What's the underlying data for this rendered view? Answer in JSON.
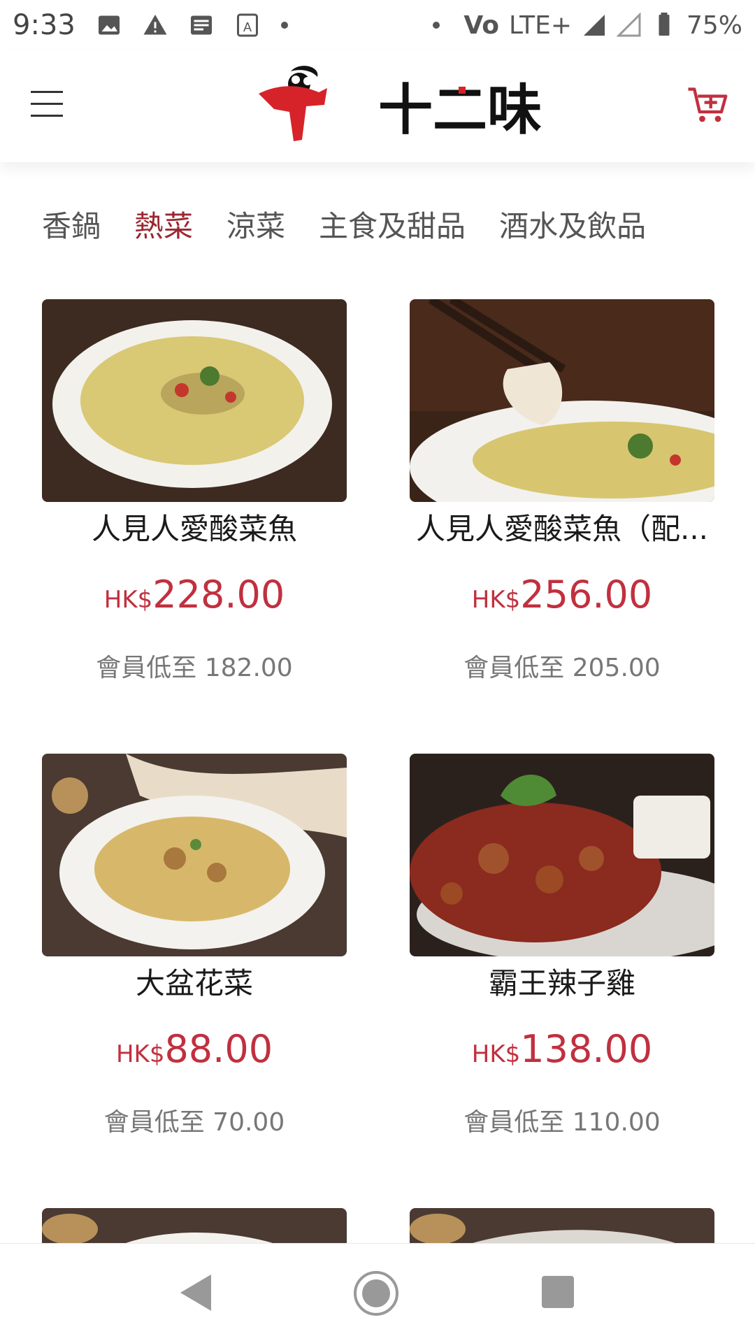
{
  "status_bar": {
    "time": "9:33",
    "network": "LTE+",
    "volte": "Vo",
    "battery": "75%",
    "icons": [
      "image-icon",
      "warning-icon",
      "message-icon",
      "translate-icon"
    ]
  },
  "header": {
    "brand_name": "十二味",
    "menu_icon": "hamburger-menu-icon",
    "cart_icon": "cart-add-icon",
    "accent_color": "#c0303f"
  },
  "tabs": [
    {
      "label": "香鍋",
      "active": false
    },
    {
      "label": "熱菜",
      "active": true
    },
    {
      "label": "涼菜",
      "active": false
    },
    {
      "label": "主食及甜品",
      "active": false
    },
    {
      "label": "酒水及飲品",
      "active": false
    }
  ],
  "products": [
    {
      "name": "人見人愛酸菜魚",
      "currency": "HK$",
      "price": "228.00",
      "member": "會員低至 182.00"
    },
    {
      "name": "人見人愛酸菜魚（配...",
      "currency": "HK$",
      "price": "256.00",
      "member": "會員低至 205.00"
    },
    {
      "name": "大盆花菜",
      "currency": "HK$",
      "price": "88.00",
      "member": "會員低至 70.00"
    },
    {
      "name": "霸王辣子雞",
      "currency": "HK$",
      "price": "138.00",
      "member": "會員低至 110.00"
    }
  ],
  "navbar": {
    "back_icon": "back-triangle-icon",
    "home_icon": "home-circle-icon",
    "recent_icon": "recent-apps-icon"
  }
}
